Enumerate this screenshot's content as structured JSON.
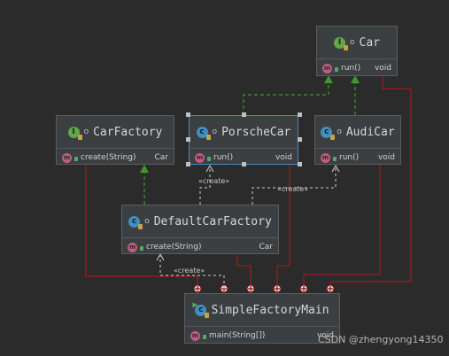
{
  "colors": {
    "background": "#2b2b2b",
    "node_bg": "#3c3f41",
    "inheritance": "#3d9a27",
    "association": "#9a1e1e",
    "create_dependency": "#cfcfcf",
    "selection": "#4a88c7"
  },
  "nodes": {
    "car": {
      "name": "Car",
      "kind": "interface",
      "icon": "interface-icon",
      "methods": [
        {
          "sig": "run()",
          "type": "void"
        }
      ]
    },
    "carfactory": {
      "name": "CarFactory",
      "kind": "interface",
      "icon": "interface-icon",
      "methods": [
        {
          "sig": "create(String)",
          "type": "Car"
        }
      ]
    },
    "porschecar": {
      "name": "PorscheCar",
      "kind": "class",
      "icon": "class-icon",
      "methods": [
        {
          "sig": "run()",
          "type": "void"
        }
      ]
    },
    "audicar": {
      "name": "AudiCar",
      "kind": "class",
      "icon": "class-icon",
      "methods": [
        {
          "sig": "run()",
          "type": "void"
        }
      ]
    },
    "defaultcarfactory": {
      "name": "DefaultCarFactory",
      "kind": "class",
      "icon": "class-icon",
      "methods": [
        {
          "sig": "create(String)",
          "type": "Car"
        }
      ]
    },
    "simplefactorymain": {
      "name": "SimpleFactoryMain",
      "kind": "class",
      "icon": "class-icon",
      "methods": [
        {
          "sig": "main(String[])",
          "type": "void"
        }
      ]
    }
  },
  "labels": {
    "icon_class": "c",
    "icon_interface": "I",
    "icon_method": "m",
    "visibility": "o",
    "create_stereotype": "«create»"
  },
  "edges": [
    {
      "from": "porschecar",
      "to": "car",
      "kind": "implements"
    },
    {
      "from": "audicar",
      "to": "car",
      "kind": "implements"
    },
    {
      "from": "defaultcarfactory",
      "to": "carfactory",
      "kind": "implements"
    },
    {
      "from": "defaultcarfactory",
      "to": "porschecar",
      "kind": "create",
      "label": "«create»"
    },
    {
      "from": "defaultcarfactory",
      "to": "audicar",
      "kind": "create",
      "label": "«create»"
    },
    {
      "from": "simplefactorymain",
      "to": "defaultcarfactory",
      "kind": "create",
      "label": "«create»"
    },
    {
      "from": "carfactory",
      "to": "simplefactorymain",
      "kind": "association"
    },
    {
      "from": "porschecar",
      "to": "simplefactorymain",
      "kind": "association"
    },
    {
      "from": "audicar",
      "to": "simplefactorymain",
      "kind": "association"
    },
    {
      "from": "car",
      "to": "simplefactorymain",
      "kind": "association"
    },
    {
      "from": "defaultcarfactory",
      "to": "simplefactorymain",
      "kind": "association"
    }
  ],
  "watermark": "CSDN @zhengyong14350"
}
